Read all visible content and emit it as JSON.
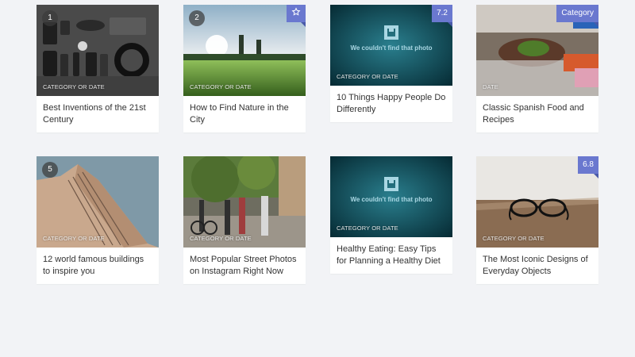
{
  "cards": [
    {
      "number": "1",
      "meta": "CATEGORY OR DATE",
      "title": "Best Inventions of the 21st Century"
    },
    {
      "number": "2",
      "badge_icon": "star-icon",
      "meta": "CATEGORY OR DATE",
      "title": "How to Find Nature in the City"
    },
    {
      "badge": "7.2",
      "meta": "CATEGORY OR DATE",
      "title": "10 Things Happy People Do Differently",
      "missing_photo": "We couldn't find that photo"
    },
    {
      "badge": "Category",
      "meta": "DATE",
      "title": "Classic Spanish Food and Recipes"
    },
    {
      "number": "5",
      "meta": "CATEGORY OR DATE",
      "title": "12 world famous buildings to inspire you"
    },
    {
      "meta": "CATEGORY OR DATE",
      "title": "Most Popular Street Photos on Instagram Right Now"
    },
    {
      "meta": "CATEGORY OR DATE",
      "title": "Healthy Eating: Easy Tips for Planning a Healthy Diet",
      "missing_photo": "We couldn't find that photo"
    },
    {
      "badge": "6.8",
      "meta": "CATEGORY OR DATE",
      "title": "The Most Iconic Designs of Everyday Objects"
    }
  ],
  "colors": {
    "badge": "#6a78cf",
    "background": "#f2f3f6"
  }
}
